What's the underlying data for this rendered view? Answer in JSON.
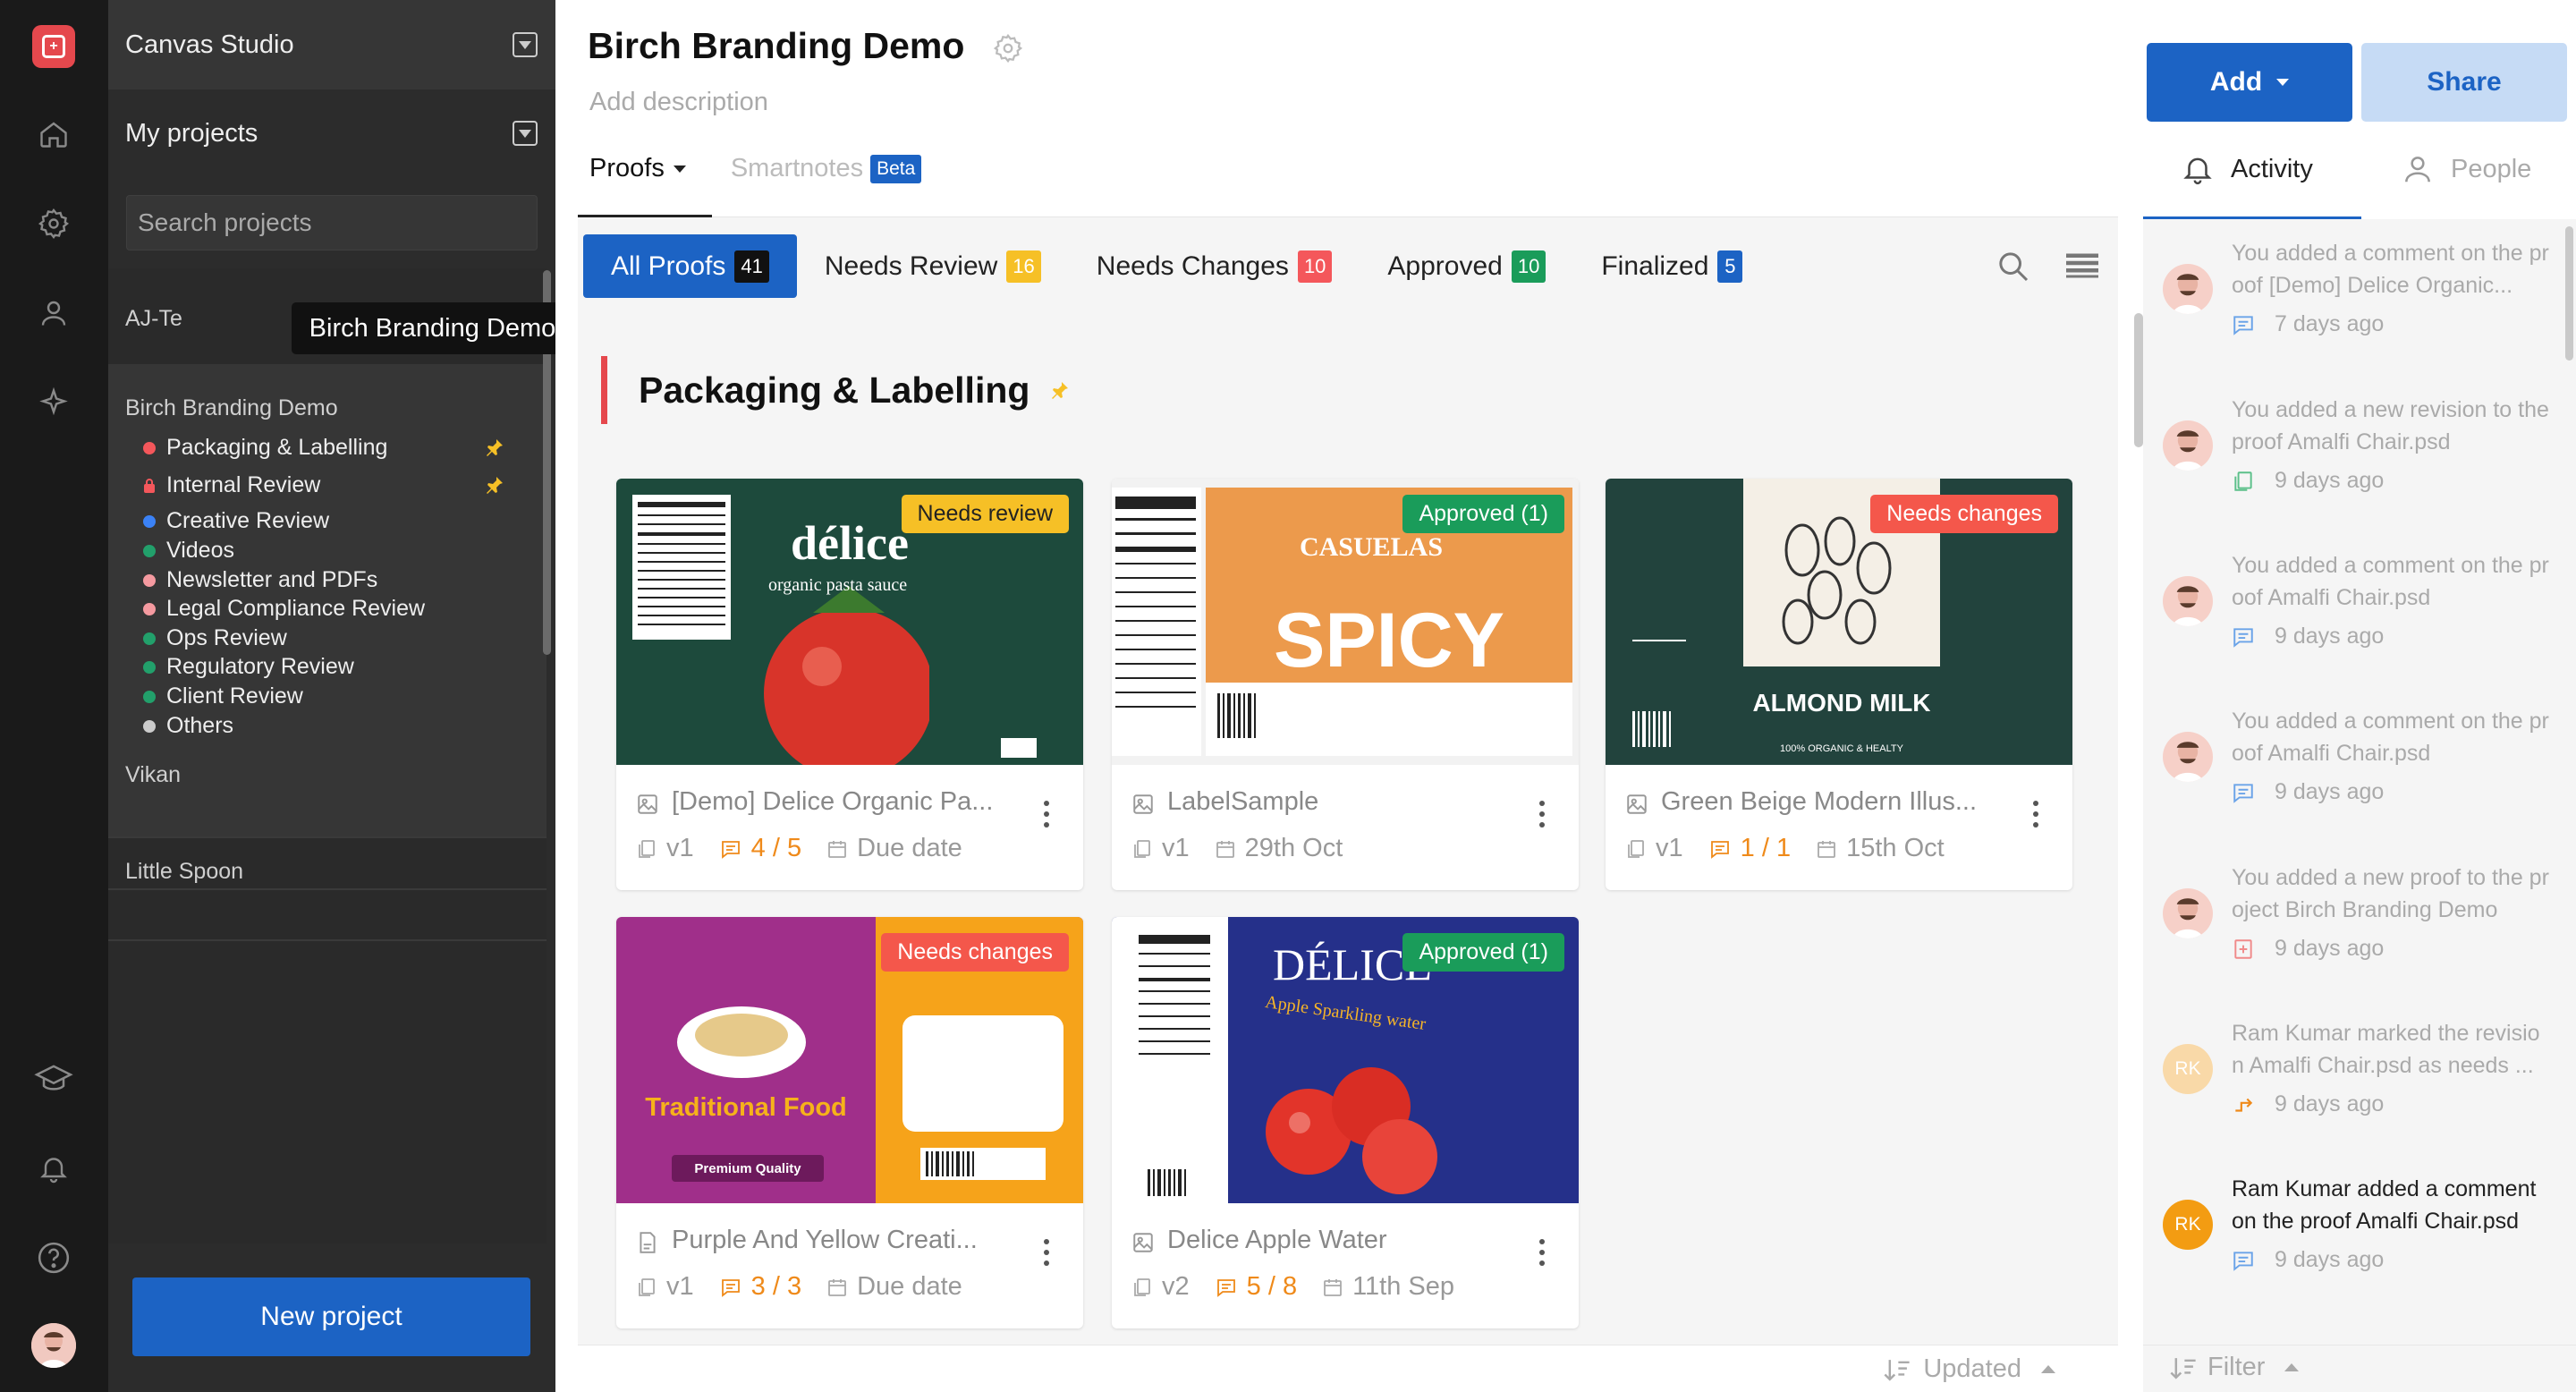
{
  "app": {
    "workspace": "Canvas Studio",
    "my_projects": "My projects",
    "search_placeholder": "Search projects",
    "new_project": "New project",
    "tooltip": "Birch Branding Demo"
  },
  "sidebar": {
    "groups": [
      "AJ-Te",
      "Birch Branding Demo",
      "Vikan",
      "Little Spoon"
    ],
    "items": [
      {
        "label": "Packaging & Labelling",
        "color": "#f4575b",
        "pinned": true
      },
      {
        "label": "Internal Review",
        "color": "#f4575b",
        "locked": true,
        "pinned": true
      },
      {
        "label": "Creative Review",
        "color": "#3b82f6"
      },
      {
        "label": "Videos",
        "color": "#22a06b"
      },
      {
        "label": "Newsletter and PDFs",
        "color": "#f59aa0"
      },
      {
        "label": "Legal Compliance Review",
        "color": "#f59aa0"
      },
      {
        "label": "Ops Review",
        "color": "#22a06b"
      },
      {
        "label": "Regulatory Review",
        "color": "#22a06b"
      },
      {
        "label": "Client Review",
        "color": "#22a06b"
      },
      {
        "label": "Others",
        "color": "#cccccc"
      }
    ]
  },
  "header": {
    "title": "Birch Branding Demo",
    "description": "Add description",
    "tab_proofs": "Proofs",
    "tab_smartnotes": "Smartnotes",
    "beta": "Beta"
  },
  "filters": [
    {
      "label": "All Proofs",
      "count": "41",
      "color": "#111111"
    },
    {
      "label": "Needs Review",
      "count": "16",
      "color": "#f6c026"
    },
    {
      "label": "Needs Changes",
      "count": "10",
      "color": "#f4575b"
    },
    {
      "label": "Approved",
      "count": "10",
      "color": "#1a9c5a"
    },
    {
      "label": "Finalized",
      "count": "5",
      "color": "#1c63c4"
    }
  ],
  "section": {
    "title": "Packaging & Labelling"
  },
  "cards": [
    {
      "name": "[Demo] Delice Organic Pa...",
      "status": "Needs review",
      "status_color": "#f6c026",
      "status_text_color": "#222222",
      "version": "v1",
      "comments": "4 / 5",
      "date": "Due date",
      "thumb_text": "délice",
      "thumb_sub": "organic pasta sauce"
    },
    {
      "name": "LabelSample",
      "status": "Approved (1)",
      "status_color": "#1a9c5a",
      "status_text_color": "#ffffff",
      "version": "v1",
      "comments": "",
      "date": "29th Oct",
      "thumb_text": "SPICY",
      "thumb_sub": "CASUELAS"
    },
    {
      "name": "Green Beige Modern Illus...",
      "status": "Needs changes",
      "status_color": "#f4574b",
      "status_text_color": "#ffffff",
      "version": "v1",
      "comments": "1 / 1",
      "date": "15th Oct",
      "thumb_text": "ALMOND MILK",
      "thumb_sub": "100% ORGANIC & HEALTY"
    },
    {
      "name": "Purple And Yellow Creati...",
      "status": "Needs changes",
      "status_color": "#f4574b",
      "status_text_color": "#ffffff",
      "version": "v1",
      "comments": "3 / 3",
      "date": "Due date",
      "thumb_text": "Traditional Food",
      "thumb_sub": "Premium Quality"
    },
    {
      "name": "Delice Apple Water",
      "status": "Approved (1)",
      "status_color": "#1a9c5a",
      "status_text_color": "#ffffff",
      "version": "v2",
      "comments": "5 / 8",
      "date": "11th Sep",
      "thumb_text": "DÉLICE",
      "thumb_sub": "Apple Sparkling water"
    }
  ],
  "sort": {
    "label": "Updated"
  },
  "right": {
    "add": "Add",
    "share": "Share",
    "tab_activity": "Activity",
    "tab_people": "People",
    "filter": "Filter"
  },
  "activity": [
    {
      "text": "You added a comment on the proof [Demo] Delice Organic...",
      "time": "7 days ago",
      "icon": "comment-icon",
      "avatar": "photo"
    },
    {
      "text": "You added a new revision to the proof Amalfi Chair.psd",
      "time": "9 days ago",
      "icon": "revision-icon",
      "avatar": "photo"
    },
    {
      "text": "You added a comment on the proof Amalfi Chair.psd",
      "time": "9 days ago",
      "icon": "comment-icon",
      "avatar": "photo"
    },
    {
      "text": "You added a comment on the proof Amalfi Chair.psd",
      "time": "9 days ago",
      "icon": "comment-icon",
      "avatar": "photo"
    },
    {
      "text": "You added a new proof to the project Birch Branding Demo",
      "time": "9 days ago",
      "icon": "new-proof-icon",
      "avatar": "photo"
    },
    {
      "text": "Ram Kumar marked the revision Amalfi Chair.psd as needs ...",
      "time": "9 days ago",
      "icon": "status-change-icon",
      "avatar": "RK"
    },
    {
      "text": "Ram Kumar added a comment on the proof Amalfi Chair.psd",
      "time": "9 days ago",
      "icon": "comment-icon",
      "avatar": "RK"
    }
  ]
}
